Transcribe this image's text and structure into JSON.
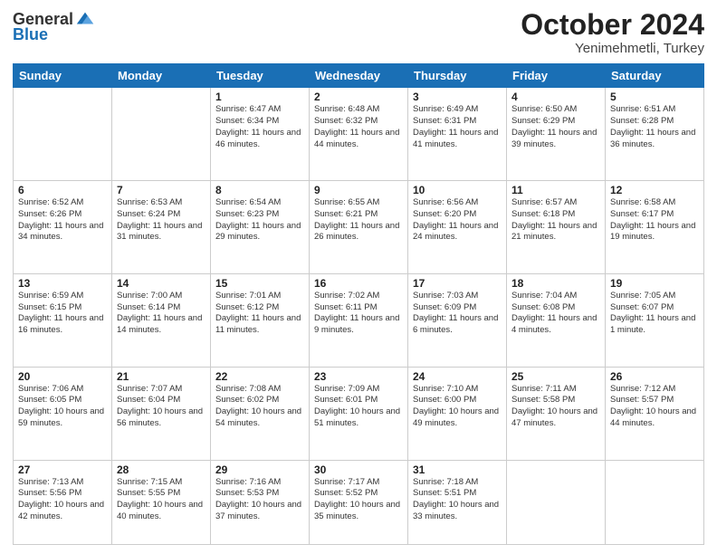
{
  "header": {
    "logo_general": "General",
    "logo_blue": "Blue",
    "title": "October 2024",
    "location": "Yenimehmetli, Turkey"
  },
  "weekdays": [
    "Sunday",
    "Monday",
    "Tuesday",
    "Wednesday",
    "Thursday",
    "Friday",
    "Saturday"
  ],
  "weeks": [
    [
      {
        "day": "",
        "info": ""
      },
      {
        "day": "",
        "info": ""
      },
      {
        "day": "1",
        "info": "Sunrise: 6:47 AM\nSunset: 6:34 PM\nDaylight: 11 hours and 46 minutes."
      },
      {
        "day": "2",
        "info": "Sunrise: 6:48 AM\nSunset: 6:32 PM\nDaylight: 11 hours and 44 minutes."
      },
      {
        "day": "3",
        "info": "Sunrise: 6:49 AM\nSunset: 6:31 PM\nDaylight: 11 hours and 41 minutes."
      },
      {
        "day": "4",
        "info": "Sunrise: 6:50 AM\nSunset: 6:29 PM\nDaylight: 11 hours and 39 minutes."
      },
      {
        "day": "5",
        "info": "Sunrise: 6:51 AM\nSunset: 6:28 PM\nDaylight: 11 hours and 36 minutes."
      }
    ],
    [
      {
        "day": "6",
        "info": "Sunrise: 6:52 AM\nSunset: 6:26 PM\nDaylight: 11 hours and 34 minutes."
      },
      {
        "day": "7",
        "info": "Sunrise: 6:53 AM\nSunset: 6:24 PM\nDaylight: 11 hours and 31 minutes."
      },
      {
        "day": "8",
        "info": "Sunrise: 6:54 AM\nSunset: 6:23 PM\nDaylight: 11 hours and 29 minutes."
      },
      {
        "day": "9",
        "info": "Sunrise: 6:55 AM\nSunset: 6:21 PM\nDaylight: 11 hours and 26 minutes."
      },
      {
        "day": "10",
        "info": "Sunrise: 6:56 AM\nSunset: 6:20 PM\nDaylight: 11 hours and 24 minutes."
      },
      {
        "day": "11",
        "info": "Sunrise: 6:57 AM\nSunset: 6:18 PM\nDaylight: 11 hours and 21 minutes."
      },
      {
        "day": "12",
        "info": "Sunrise: 6:58 AM\nSunset: 6:17 PM\nDaylight: 11 hours and 19 minutes."
      }
    ],
    [
      {
        "day": "13",
        "info": "Sunrise: 6:59 AM\nSunset: 6:15 PM\nDaylight: 11 hours and 16 minutes."
      },
      {
        "day": "14",
        "info": "Sunrise: 7:00 AM\nSunset: 6:14 PM\nDaylight: 11 hours and 14 minutes."
      },
      {
        "day": "15",
        "info": "Sunrise: 7:01 AM\nSunset: 6:12 PM\nDaylight: 11 hours and 11 minutes."
      },
      {
        "day": "16",
        "info": "Sunrise: 7:02 AM\nSunset: 6:11 PM\nDaylight: 11 hours and 9 minutes."
      },
      {
        "day": "17",
        "info": "Sunrise: 7:03 AM\nSunset: 6:09 PM\nDaylight: 11 hours and 6 minutes."
      },
      {
        "day": "18",
        "info": "Sunrise: 7:04 AM\nSunset: 6:08 PM\nDaylight: 11 hours and 4 minutes."
      },
      {
        "day": "19",
        "info": "Sunrise: 7:05 AM\nSunset: 6:07 PM\nDaylight: 11 hours and 1 minute."
      }
    ],
    [
      {
        "day": "20",
        "info": "Sunrise: 7:06 AM\nSunset: 6:05 PM\nDaylight: 10 hours and 59 minutes."
      },
      {
        "day": "21",
        "info": "Sunrise: 7:07 AM\nSunset: 6:04 PM\nDaylight: 10 hours and 56 minutes."
      },
      {
        "day": "22",
        "info": "Sunrise: 7:08 AM\nSunset: 6:02 PM\nDaylight: 10 hours and 54 minutes."
      },
      {
        "day": "23",
        "info": "Sunrise: 7:09 AM\nSunset: 6:01 PM\nDaylight: 10 hours and 51 minutes."
      },
      {
        "day": "24",
        "info": "Sunrise: 7:10 AM\nSunset: 6:00 PM\nDaylight: 10 hours and 49 minutes."
      },
      {
        "day": "25",
        "info": "Sunrise: 7:11 AM\nSunset: 5:58 PM\nDaylight: 10 hours and 47 minutes."
      },
      {
        "day": "26",
        "info": "Sunrise: 7:12 AM\nSunset: 5:57 PM\nDaylight: 10 hours and 44 minutes."
      }
    ],
    [
      {
        "day": "27",
        "info": "Sunrise: 7:13 AM\nSunset: 5:56 PM\nDaylight: 10 hours and 42 minutes."
      },
      {
        "day": "28",
        "info": "Sunrise: 7:15 AM\nSunset: 5:55 PM\nDaylight: 10 hours and 40 minutes."
      },
      {
        "day": "29",
        "info": "Sunrise: 7:16 AM\nSunset: 5:53 PM\nDaylight: 10 hours and 37 minutes."
      },
      {
        "day": "30",
        "info": "Sunrise: 7:17 AM\nSunset: 5:52 PM\nDaylight: 10 hours and 35 minutes."
      },
      {
        "day": "31",
        "info": "Sunrise: 7:18 AM\nSunset: 5:51 PM\nDaylight: 10 hours and 33 minutes."
      },
      {
        "day": "",
        "info": ""
      },
      {
        "day": "",
        "info": ""
      }
    ]
  ]
}
